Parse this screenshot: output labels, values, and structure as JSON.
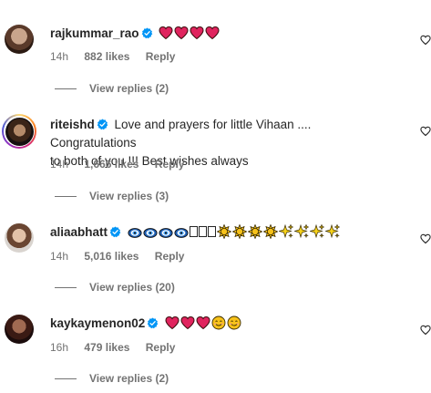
{
  "comments": [
    {
      "username": "rajkummar_rao",
      "text": "",
      "text2": "",
      "time": "14h",
      "likes": "882 likes",
      "reply": "Reply",
      "view_replies": "View replies (2)"
    },
    {
      "username": "riteishd",
      "text": "Love and prayers for little Vihaan .... Congratulations",
      "text2": "to both of you !!! Best wishes always",
      "time": "14h",
      "likes": "1,666 likes",
      "reply": "Reply",
      "view_replies": "View replies (3)"
    },
    {
      "username": "aliaabhatt",
      "text": "",
      "text2": "",
      "time": "14h",
      "likes": "5,016 likes",
      "reply": "Reply",
      "view_replies": "View replies (20)"
    },
    {
      "username": "kaykaymenon02",
      "text": "",
      "text2": "",
      "time": "16h",
      "likes": "479 likes",
      "reply": "Reply",
      "view_replies": "View replies (2)"
    }
  ],
  "icons": {
    "verified": "verified-badge-icon",
    "like": "heart-outline-icon",
    "emoji_heart": "red-heart-emoji",
    "emoji_evil_eye": "evil-eye-emoji",
    "emoji_sun": "sun-emoji",
    "emoji_sparkles": "sparkles-emoji",
    "emoji_smile": "smiling-face-emoji"
  },
  "colors": {
    "verified_blue": "#0095f6",
    "text": "#262626",
    "secondary": "#737373",
    "heart_red": "#e0245e"
  }
}
